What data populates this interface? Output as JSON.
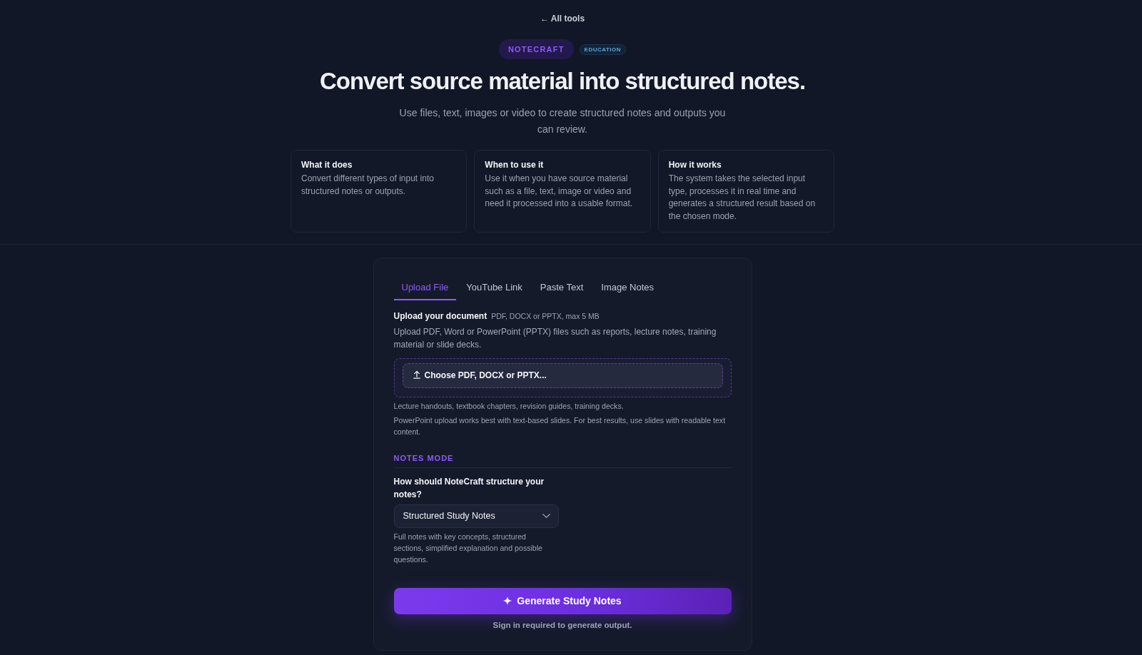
{
  "back_link": "← All tools",
  "header": {
    "brand_badge": "NOTECRAFT",
    "category_badge": "EDUCATION",
    "title": "Convert source material into structured notes.",
    "subtitle": "Use files, text, images or video to create structured notes and outputs you can review."
  },
  "info_cards": [
    {
      "title": "What it does",
      "text": "Convert different types of input into structured notes or outputs."
    },
    {
      "title": "When to use it",
      "text": "Use it when you have source material such as a file, text, image or video and need it processed into a usable format."
    },
    {
      "title": "How it works",
      "text": "The system takes the selected input type, processes it in real time and generates a structured result based on the chosen mode."
    }
  ],
  "form": {
    "tabs": [
      {
        "label": "Upload File",
        "selected": true
      },
      {
        "label": "YouTube Link",
        "selected": false
      },
      {
        "label": "Paste Text",
        "selected": false
      },
      {
        "label": "Image Notes",
        "selected": false
      }
    ],
    "upload": {
      "label": "Upload your document",
      "hint": "PDF, DOCX or PPTX, max 5 MB",
      "description": "Upload PDF, Word or PowerPoint (PPTX) files such as reports, lecture notes, training material or slide decks.",
      "button": "Choose PDF, DOCX or PPTX...",
      "notes": [
        "Lecture handouts, textbook chapters, revision guides, training decks.",
        "PowerPoint upload works best with text-based slides. For best results, use slides with readable text content."
      ]
    },
    "notes_mode": {
      "heading": "NOTES MODE",
      "question": "How should NoteCraft structure your notes?",
      "select_value": "Structured Study Notes",
      "description": "Full notes with key concepts, structured sections, simplified explanation and possible questions."
    },
    "generate_button": "Generate Study Notes",
    "sign_in_note": "Sign in required to generate output."
  }
}
